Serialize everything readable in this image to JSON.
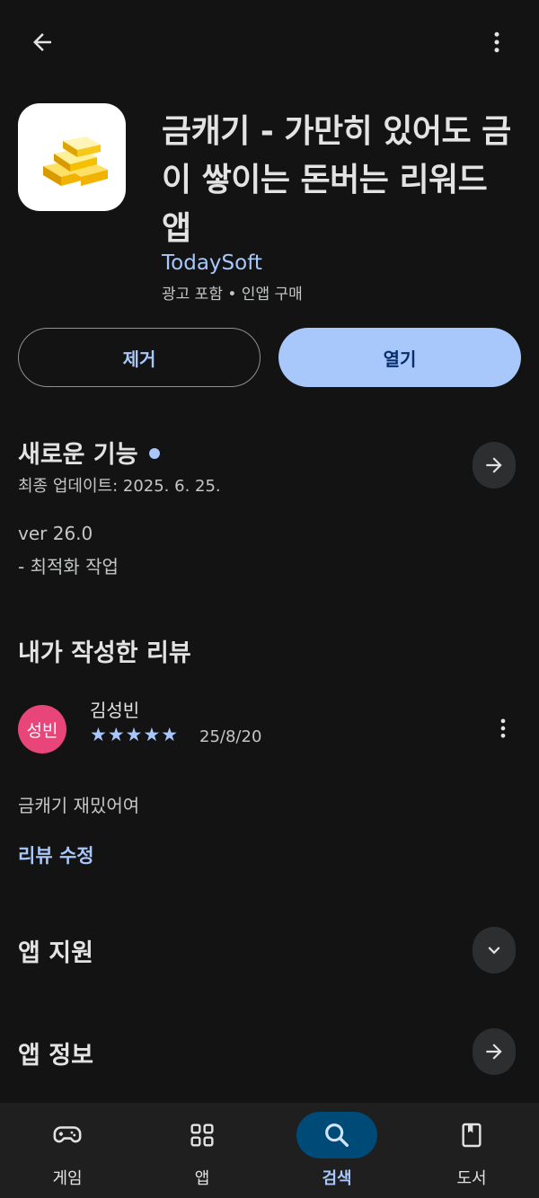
{
  "app": {
    "title": "금캐기 - 가만히 있어도 금이 쌓이는 돈버는 리워드 앱",
    "developer": "TodaySoft",
    "meta": "광고 포함 • 인앱 구매"
  },
  "actions": {
    "remove_label": "제거",
    "open_label": "열기"
  },
  "whats_new": {
    "title": "새로운 기능",
    "updated": "최종 업데이트: 2025. 6. 25.",
    "version": "ver 26.0",
    "note": "- 최적화 작업"
  },
  "my_review": {
    "section_title": "내가 작성한 리뷰",
    "avatar_text": "성빈",
    "reviewer": "김성빈",
    "stars": "★★★★★",
    "rating": 5,
    "date": "25/8/20",
    "text": "금캐기 재밌어여",
    "edit_label": "리뷰 수정"
  },
  "app_support": {
    "title": "앱 지원"
  },
  "app_info": {
    "title": "앱 정보"
  },
  "nav": {
    "items": [
      {
        "label": "게임",
        "icon": "gamepad-icon",
        "active": false
      },
      {
        "label": "앱",
        "icon": "apps-grid-icon",
        "active": false
      },
      {
        "label": "검색",
        "icon": "search-icon",
        "active": true
      },
      {
        "label": "도서",
        "icon": "book-icon",
        "active": false
      }
    ]
  },
  "colors": {
    "background": "#131314",
    "accent": "#a8c7fa",
    "avatar": "#e8457a"
  }
}
